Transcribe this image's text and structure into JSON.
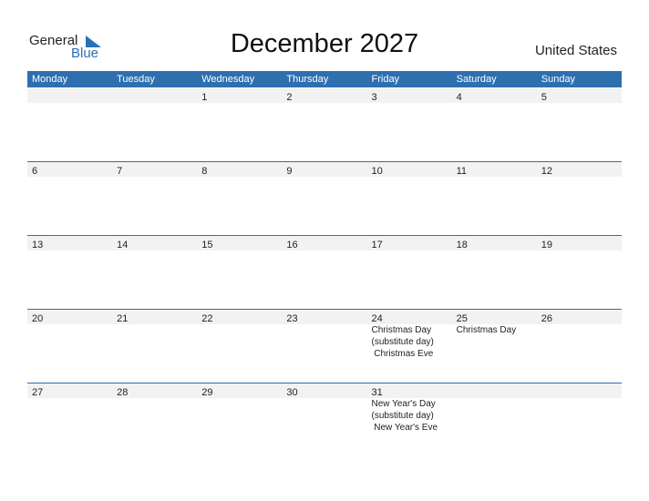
{
  "logo": {
    "general": "General",
    "blue": "Blue"
  },
  "title": "December 2027",
  "country": "United States",
  "weekdays": [
    "Monday",
    "Tuesday",
    "Wednesday",
    "Thursday",
    "Friday",
    "Saturday",
    "Sunday"
  ],
  "weeks": [
    {
      "days": [
        "",
        "",
        "1",
        "2",
        "3",
        "4",
        "5"
      ],
      "events": [
        [],
        [],
        [],
        [],
        [],
        [],
        []
      ]
    },
    {
      "days": [
        "6",
        "7",
        "8",
        "9",
        "10",
        "11",
        "12"
      ],
      "events": [
        [],
        [],
        [],
        [],
        [],
        [],
        []
      ]
    },
    {
      "days": [
        "13",
        "14",
        "15",
        "16",
        "17",
        "18",
        "19"
      ],
      "events": [
        [],
        [],
        [],
        [],
        [],
        [],
        []
      ]
    },
    {
      "days": [
        "20",
        "21",
        "22",
        "23",
        "24",
        "25",
        "26"
      ],
      "events": [
        [],
        [],
        [],
        [],
        [
          "Christmas Day",
          "(substitute day)",
          " Christmas Eve"
        ],
        [
          "Christmas Day"
        ],
        []
      ]
    },
    {
      "days": [
        "27",
        "28",
        "29",
        "30",
        "31",
        "",
        ""
      ],
      "events": [
        [],
        [],
        [],
        [],
        [
          "New Year's Day",
          "(substitute day)",
          " New Year's Eve"
        ],
        [],
        []
      ]
    }
  ],
  "colors": {
    "accent": "#2e6fb0",
    "daybar": "#f2f2f2"
  }
}
